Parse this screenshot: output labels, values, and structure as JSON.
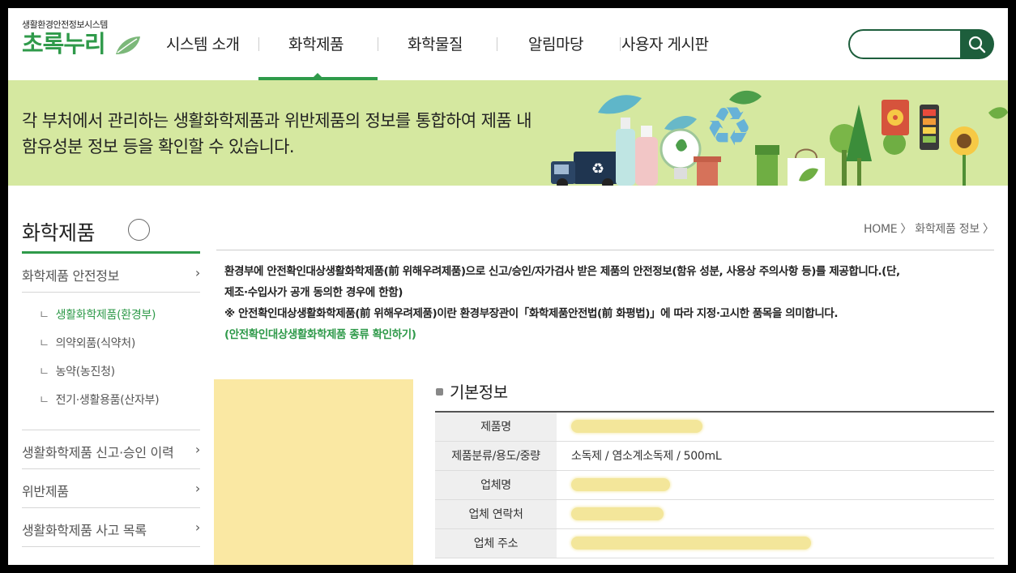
{
  "header": {
    "logo_sub": "생활환경안전정보시스템",
    "logo_main": "초록누리",
    "nav": [
      "시스템 소개",
      "화학제품",
      "화학물질",
      "알림마당",
      "사용자 게시판"
    ],
    "active_nav": "화학제품",
    "search": {
      "placeholder": "",
      "value": ""
    }
  },
  "banner": {
    "line1": "각 부처에서 관리하는 생활화학제품과 위반제품의 정보를 통합하여 제품 내",
    "line2": "함유성분 정보 등을 확인할 수 있습니다."
  },
  "sidebar": {
    "title": "화학제품",
    "items": [
      {
        "label": "화학제품 안전정보",
        "arrow": "›"
      },
      {
        "label": "생활화학제품 신고·승인 이력",
        "arrow": "›"
      },
      {
        "label": "위반제품",
        "arrow": "›"
      },
      {
        "label": "생활화학제품 사고 목록",
        "arrow": "›"
      }
    ],
    "sub_prefix": "ㄴ",
    "sub_items": [
      {
        "label": "생활화학제품(환경부)",
        "active": true
      },
      {
        "label": "의약외품(식약처)",
        "active": false
      },
      {
        "label": "농약(농진청)",
        "active": false
      },
      {
        "label": "전기·생활용품(산자부)",
        "active": false
      }
    ]
  },
  "breadcrumb": "HOME 〉 화학제품 정보 〉",
  "notice": {
    "line1": "환경부에 안전확인대상생활화학제품(前 위해우려제품)으로 신고/승인/자가검사 받은 제품의 안전정보(함유 성분, 사용상 주의사항 등)를 제공합니다.(단,",
    "line2": "제조·수입사가 공개 동의한 경우에 한함)",
    "line3": "※ 안전확인대상생활화학제품(前 위해우려제품)이란 환경부장관이「화학제품안전법(前 화평법)」에 따라 지정·고시한 품목을 의미합니다.",
    "link": "(안전확인대상생활화학제품 종류 확인하기)"
  },
  "basic_info": {
    "title": "기본정보",
    "rows": [
      {
        "label": "제품명",
        "value": "",
        "redacted": true
      },
      {
        "label": "제품분류/용도/중량",
        "value": "소독제 / 염소계소독제 / 500mL",
        "redacted": false
      },
      {
        "label": "업체명",
        "value": "",
        "redacted": true
      },
      {
        "label": "업체 연락처",
        "value": "",
        "redacted": true
      },
      {
        "label": "업체 주소",
        "value": "",
        "redacted": true
      }
    ]
  },
  "colors": {
    "brand_green": "#2f9a4a",
    "dark_green": "#1d5e3c",
    "banner_bg": "#d5e8a0",
    "image_placeholder": "#fae8a3"
  }
}
